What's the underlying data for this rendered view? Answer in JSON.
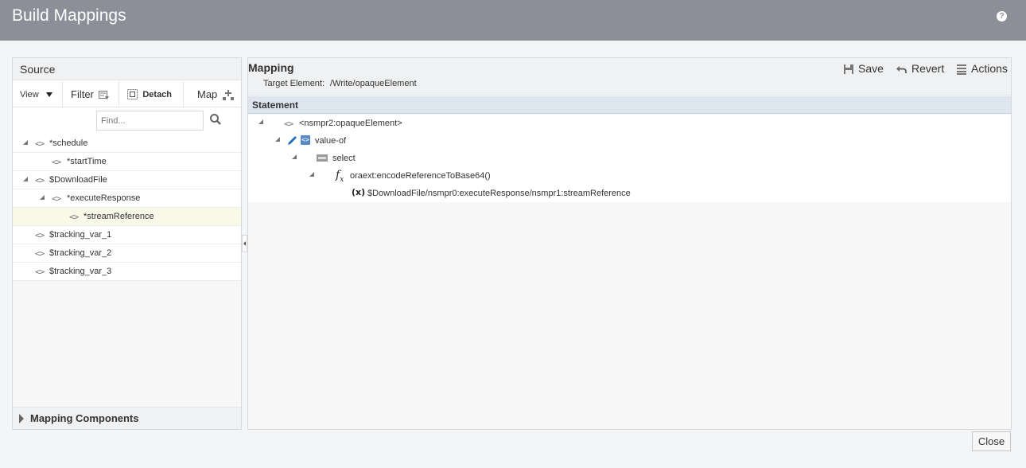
{
  "title": "Build Mappings",
  "help_glyph": "?",
  "source": {
    "header": "Source",
    "toolbar": {
      "view": "View",
      "filter": "Filter",
      "detach": "Detach",
      "map": "Map"
    },
    "find_placeholder": "Find...",
    "tree": [
      {
        "label": "*schedule"
      },
      {
        "label": "*startTime"
      },
      {
        "label": "$DownloadFile"
      },
      {
        "label": "*executeResponse"
      },
      {
        "label": "*streamReference"
      },
      {
        "label": "$tracking_var_1"
      },
      {
        "label": "$tracking_var_2"
      },
      {
        "label": "$tracking_var_3"
      }
    ],
    "tag_glyph": "<>",
    "mapping_components": "Mapping Components"
  },
  "mapping": {
    "title": "Mapping",
    "target_label": "Target Element:",
    "target_value": "/Write/opaqueElement",
    "save": "Save",
    "revert": "Revert",
    "actions": "Actions",
    "statement_header": "Statement",
    "statement": [
      {
        "label": "<nsmpr2:opaqueElement>"
      },
      {
        "label": "value-of"
      },
      {
        "label": "select"
      },
      {
        "label": "oraext:encodeReferenceToBase64()"
      },
      {
        "label": "$DownloadFile/nsmpr0:executeResponse/nsmpr1:streamReference"
      }
    ]
  },
  "close": "Close"
}
